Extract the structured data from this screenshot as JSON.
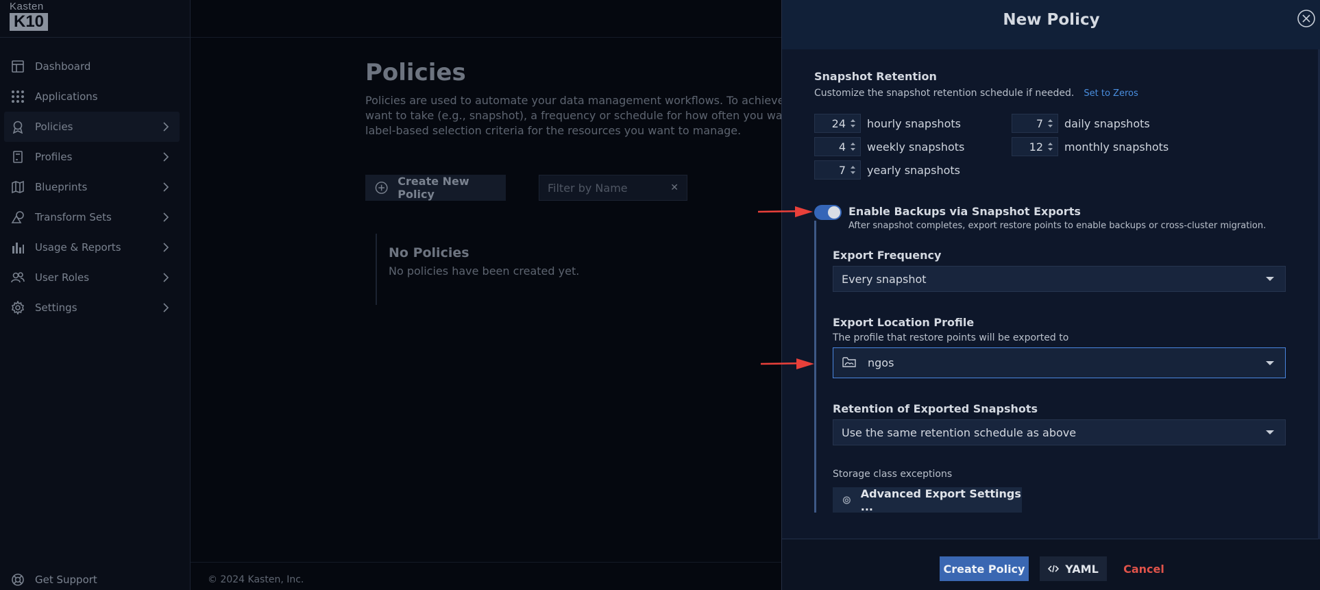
{
  "sidebar": {
    "logo_top": "Kasten",
    "logo_box": "K10",
    "items": [
      {
        "label": "Dashboard",
        "icon": "dashboard-icon"
      },
      {
        "label": "Applications",
        "icon": "grid-dots-icon"
      },
      {
        "label": "Policies",
        "icon": "policy-ribbon-icon",
        "active": true
      },
      {
        "label": "Profiles",
        "icon": "profile-doc-icon"
      },
      {
        "label": "Blueprints",
        "icon": "map-icon"
      },
      {
        "label": "Transform Sets",
        "icon": "shapes-icon"
      },
      {
        "label": "Usage & Reports",
        "icon": "bar-chart-icon"
      },
      {
        "label": "User Roles",
        "icon": "users-icon"
      },
      {
        "label": "Settings",
        "icon": "gear-icon"
      }
    ],
    "support": "Get Support"
  },
  "main": {
    "title": "Policies",
    "description_lines": [
      "Policies are used to automate your data management workflows. To achieve this, they combine actions you",
      "want to take (e.g., snapshot), a frequency or schedule for how often you want to take that action, and a",
      "label-based selection criteria for the resources you want to manage."
    ],
    "create_label": "Create New Policy",
    "filter_placeholder": "Filter by Name",
    "empty_title": "No Policies",
    "empty_sub": "No policies have been created yet.",
    "copyright": "© 2024 Kasten, Inc."
  },
  "drawer": {
    "title": "New Policy",
    "retention": {
      "title": "Snapshot Retention",
      "subtitle": "Customize the snapshot retention schedule if needed.",
      "link": "Set to Zeros",
      "hourly": {
        "value": "24",
        "label": "hourly snapshots"
      },
      "daily": {
        "value": "7",
        "label": "daily snapshots"
      },
      "weekly": {
        "value": "4",
        "label": "weekly snapshots"
      },
      "monthly": {
        "value": "12",
        "label": "monthly snapshots"
      },
      "yearly": {
        "value": "7",
        "label": "yearly snapshots"
      }
    },
    "export": {
      "enabled": true,
      "title": "Enable Backups via Snapshot Exports",
      "subtitle": "After snapshot completes, export restore points to enable backups or cross-cluster migration.",
      "frequency_label": "Export Frequency",
      "frequency_value": "Every snapshot",
      "location_label": "Export Location Profile",
      "location_sub": "The profile that restore points will be exported to",
      "location_value": "ngos",
      "retention_label": "Retention of Exported Snapshots",
      "retention_value": "Use the same retention schedule as above",
      "storage_label": "Storage class exceptions",
      "advanced_label": "Advanced Export Settings ..."
    },
    "footer": {
      "create": "Create Policy",
      "yaml": "YAML",
      "cancel": "Cancel"
    }
  },
  "colors": {
    "accent": "#3a67b2",
    "cancel": "#e0534a",
    "link": "#4a8fe0",
    "annotation_arrow": "#e8403a"
  }
}
